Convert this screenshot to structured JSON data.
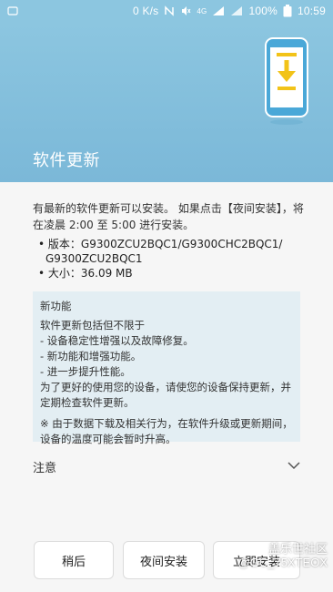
{
  "status_bar": {
    "network_speed": "0 K/s",
    "signal_label": "4G",
    "battery": "100%",
    "time": "10:59"
  },
  "header": {
    "title": "软件更新"
  },
  "content": {
    "intro": "有最新的软件更新可以安装。 如果点击【夜间安装】，将在凌晨 2:00 至 5:00 进行安装。",
    "version_line1": "• 版本：G9300ZCU2BQC1/G9300CHC2BQC1/",
    "version_line2": "G9300ZCU2BQC1",
    "size_line": "• 大小：36.09 MB",
    "features_title": "新功能",
    "features": [
      "软件更新包括但不限于",
      "- 设备稳定性增强以及故障修复。",
      "- 新功能和增强功能。",
      "- 进一步提升性能。",
      "为了更好的使用您的设备，请使您的设备保持更新，并定期检查软件更新。"
    ],
    "note": "※ 由于数据下载及相关行为，在软件升级或更新期间，设备的温度可能会暂时升高。",
    "notice_label": "注意"
  },
  "buttons": {
    "later": "稍后",
    "night_install": "夜间安装",
    "install_now": "立即安装"
  },
  "watermark": {
    "line1": "盖乐世社区",
    "line2": "@GC_75XTEOX"
  },
  "colors": {
    "header_bg": "#8cc6e0",
    "features_bg": "#e3eef3"
  }
}
